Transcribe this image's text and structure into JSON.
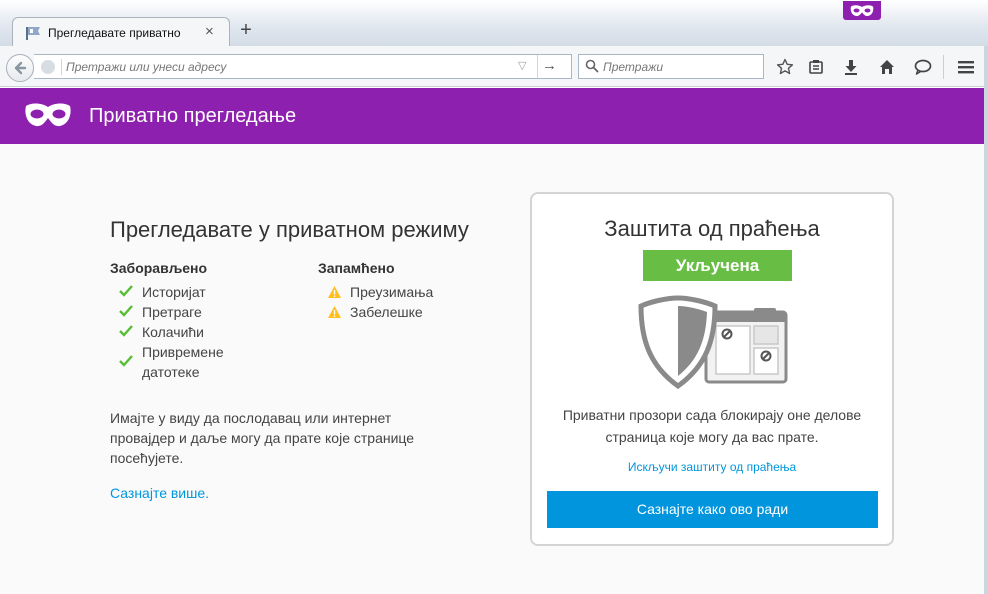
{
  "window": {
    "tab_title": "Прегледавате приватно",
    "tab_close": "×",
    "new_tab": "+"
  },
  "navbar": {
    "url_placeholder": "Претражи или унеси адресу",
    "search_placeholder": "Претражи"
  },
  "header": {
    "title": "Приватно прегледање"
  },
  "main": {
    "heading": "Прегледавате у приватном режиму",
    "forgotten": {
      "title": "Заборављено",
      "items": [
        "Историјат",
        "Претраге",
        "Колачићи",
        "Привремене датотеке"
      ]
    },
    "remembered": {
      "title": "Запамћено",
      "items": [
        "Преузимања",
        "Забелешке"
      ]
    },
    "notice": "Имајте у виду да послодавац или интернет провајдер и даље могу да прате које странице посећујете.",
    "learn_more": "Сазнајте више."
  },
  "tracking": {
    "title": "Заштита од праћења",
    "status": "Укључена",
    "description": "Приватни прозори сада блокирају оне делове страница које могу да вас прате.",
    "disable_link": "Искључи заштиту од праћења",
    "learn_button": "Сазнајте како ово ради"
  },
  "colors": {
    "private_purple": "#8d20ae",
    "status_green": "#68bd45",
    "link_blue": "#0096dd",
    "button_blue": "#0095dd"
  },
  "icons": [
    "private-mask-icon",
    "back-icon",
    "globe-icon",
    "dropmarker-icon",
    "go-arrow-icon",
    "search-icon",
    "bookmark-star-icon",
    "reading-list-icon",
    "download-icon",
    "home-icon",
    "chat-icon",
    "menu-icon",
    "checkmark-icon",
    "warning-icon",
    "shield-icon",
    "blocked-page-icon"
  ]
}
